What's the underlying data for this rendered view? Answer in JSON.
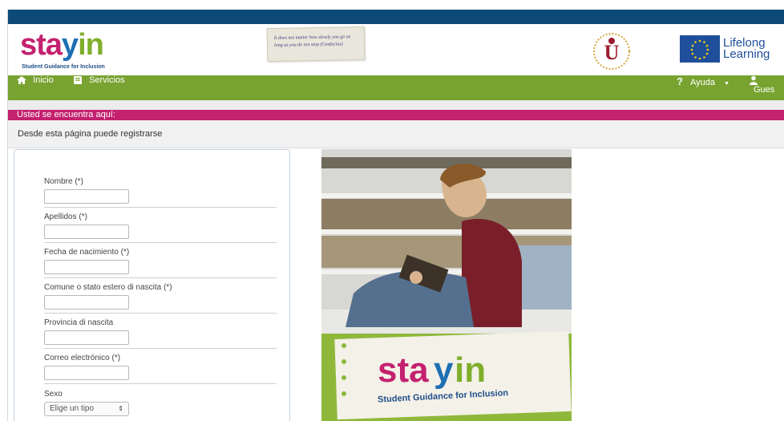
{
  "brand": {
    "word_a": "sta",
    "word_b": "y",
    "word_c": "in",
    "tagline": "Student Guidance for Inclusion"
  },
  "header": {
    "note_text": "It does not matter how slowly you go as long as you do not stop (Confucius)",
    "eu_line1": "Lifelong",
    "eu_line2": "Learning"
  },
  "nav": {
    "home_label": "Inicio",
    "services_label": "Servicios",
    "help_label": "Ayuda",
    "user_label": "Gues"
  },
  "breadcrumb": {
    "label": "Usted se encuentra aquí:"
  },
  "info": {
    "text": "Desde esta página puede registrarse"
  },
  "form": {
    "nombre": {
      "label": "Nombre (*)",
      "value": ""
    },
    "apellidos": {
      "label": "Apellidos (*)",
      "value": ""
    },
    "fecha": {
      "label": "Fecha de nacimiento (*)",
      "value": ""
    },
    "comune": {
      "label": "Comune o stato estero di nascita (*)",
      "value": ""
    },
    "provincia": {
      "label": "Provincia di nascita",
      "value": ""
    },
    "correo": {
      "label": "Correo electrónico (*)",
      "value": ""
    },
    "sexo": {
      "label": "Sexo",
      "selected": "Elige un tipo"
    }
  },
  "colors": {
    "topbar": "#0d4a78",
    "nav": "#78a331",
    "accent": "#c4216f",
    "brand_blue": "#1f6fb3"
  }
}
